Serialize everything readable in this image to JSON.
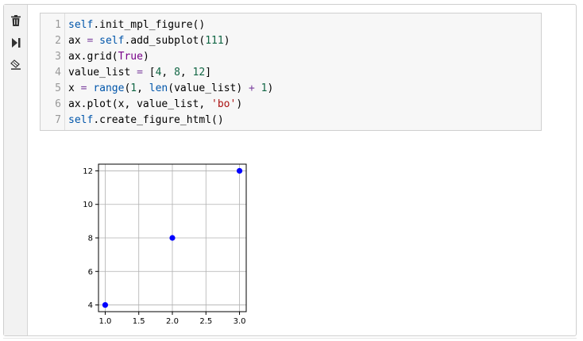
{
  "toolbar": {
    "icons": [
      "trash-icon",
      "run-icon",
      "eraser-icon"
    ]
  },
  "code_cell": {
    "lines": [
      {
        "n": "1",
        "tokens": [
          {
            "t": "self",
            "c": "#0055aa"
          },
          {
            "t": ".init_mpl_figure()",
            "c": "#000000"
          }
        ]
      },
      {
        "n": "2",
        "tokens": [
          {
            "t": "ax ",
            "c": "#000000"
          },
          {
            "t": "=",
            "c": "#7a3e9d"
          },
          {
            "t": " ",
            "c": "#000000"
          },
          {
            "t": "self",
            "c": "#0055aa"
          },
          {
            "t": ".add_subplot(",
            "c": "#000000"
          },
          {
            "t": "111",
            "c": "#116644"
          },
          {
            "t": ")",
            "c": "#000000"
          }
        ]
      },
      {
        "n": "3",
        "tokens": [
          {
            "t": "ax.grid(",
            "c": "#000000"
          },
          {
            "t": "True",
            "c": "#770088"
          },
          {
            "t": ")",
            "c": "#000000"
          }
        ]
      },
      {
        "n": "4",
        "tokens": [
          {
            "t": "value_list ",
            "c": "#000000"
          },
          {
            "t": "=",
            "c": "#7a3e9d"
          },
          {
            "t": " [",
            "c": "#000000"
          },
          {
            "t": "4",
            "c": "#116644"
          },
          {
            "t": ", ",
            "c": "#000000"
          },
          {
            "t": "8",
            "c": "#116644"
          },
          {
            "t": ", ",
            "c": "#000000"
          },
          {
            "t": "12",
            "c": "#116644"
          },
          {
            "t": "]",
            "c": "#000000"
          }
        ]
      },
      {
        "n": "5",
        "tokens": [
          {
            "t": "x ",
            "c": "#000000"
          },
          {
            "t": "=",
            "c": "#7a3e9d"
          },
          {
            "t": " ",
            "c": "#000000"
          },
          {
            "t": "range",
            "c": "#0055aa"
          },
          {
            "t": "(",
            "c": "#000000"
          },
          {
            "t": "1",
            "c": "#116644"
          },
          {
            "t": ", ",
            "c": "#000000"
          },
          {
            "t": "len",
            "c": "#0055aa"
          },
          {
            "t": "(value_list) ",
            "c": "#000000"
          },
          {
            "t": "+",
            "c": "#7a3e9d"
          },
          {
            "t": " ",
            "c": "#000000"
          },
          {
            "t": "1",
            "c": "#116644"
          },
          {
            "t": ")",
            "c": "#000000"
          }
        ]
      },
      {
        "n": "6",
        "tokens": [
          {
            "t": "ax.plot(x, value_list, ",
            "c": "#000000"
          },
          {
            "t": "'bo'",
            "c": "#aa1111"
          },
          {
            "t": ")",
            "c": "#000000"
          }
        ]
      },
      {
        "n": "7",
        "tokens": [
          {
            "t": "self",
            "c": "#0055aa"
          },
          {
            "t": ".create_figure_html()",
            "c": "#000000"
          }
        ]
      }
    ]
  },
  "chart_data": {
    "type": "scatter",
    "x": [
      1,
      2,
      3
    ],
    "y": [
      4,
      8,
      12
    ],
    "marker_color": "#0000ff",
    "grid": true,
    "xlim": [
      0.9,
      3.1
    ],
    "ylim": [
      3.6,
      12.4
    ],
    "xticks": [
      "1.0",
      "1.5",
      "2.0",
      "2.5",
      "3.0"
    ],
    "xtick_values": [
      1.0,
      1.5,
      2.0,
      2.5,
      3.0
    ],
    "yticks": [
      "4",
      "6",
      "8",
      "10",
      "12"
    ],
    "ytick_values": [
      4,
      6,
      8,
      10,
      12
    ],
    "title": "",
    "xlabel": "",
    "ylabel": ""
  }
}
